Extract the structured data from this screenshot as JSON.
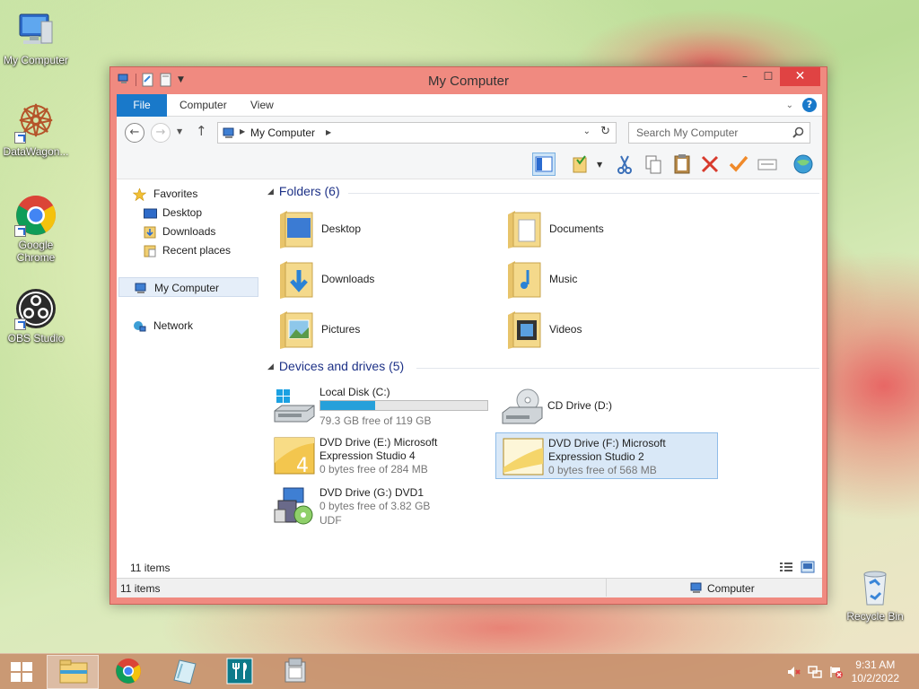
{
  "desktop": {
    "icons": [
      {
        "label": "My Computer",
        "icon": "computer-icon"
      },
      {
        "label": "DataWagon...",
        "icon": "datawagon-icon"
      },
      {
        "label": "Google Chrome",
        "icon": "chrome-icon"
      },
      {
        "label": "OBS Studio",
        "icon": "obs-icon"
      },
      {
        "label": "Recycle Bin",
        "icon": "recycle-bin-icon"
      }
    ]
  },
  "window": {
    "title": "My Computer",
    "controls": {
      "minimize": "–",
      "maximize": "☐",
      "close": "✕"
    },
    "ribbon_tabs": [
      "File",
      "Computer",
      "View"
    ],
    "help": "?",
    "address": {
      "path": "My Computer"
    },
    "search": {
      "placeholder": "Search My Computer"
    },
    "nav_pane": {
      "favorites_label": "Favorites",
      "favorites": [
        "Desktop",
        "Downloads",
        "Recent places"
      ],
      "computer": "My Computer",
      "network": "Network"
    },
    "folders": {
      "heading": "Folders (6)",
      "items": [
        "Desktop",
        "Documents",
        "Downloads",
        "Music",
        "Pictures",
        "Videos"
      ]
    },
    "devices": {
      "heading": "Devices and drives (5)",
      "items": [
        {
          "name": "Local Disk (C:)",
          "free": "79.3 GB free of 119 GB",
          "used_fraction": 0.33
        },
        {
          "name": "CD Drive (D:)"
        },
        {
          "name": "DVD Drive (E:) Microsoft Expression Studio 4",
          "free": "0 bytes free of 284 MB"
        },
        {
          "name": "DVD Drive (F:) Microsoft Expression Studio 2",
          "free": "0 bytes free of 568 MB"
        },
        {
          "name": "DVD Drive (G:) DVD1",
          "free": "0 bytes free of 3.82 GB",
          "fs": "UDF"
        }
      ]
    },
    "item_count": "11 items",
    "status": {
      "left": "11 items",
      "right": "Computer"
    }
  },
  "taskbar": {
    "clock": {
      "time": "9:31 AM",
      "date": "10/2/2022"
    }
  },
  "colors": {
    "accent": "#1979ca",
    "window_frame": "#f08a80",
    "close": "#e04343",
    "link_blue": "#1e3287"
  }
}
